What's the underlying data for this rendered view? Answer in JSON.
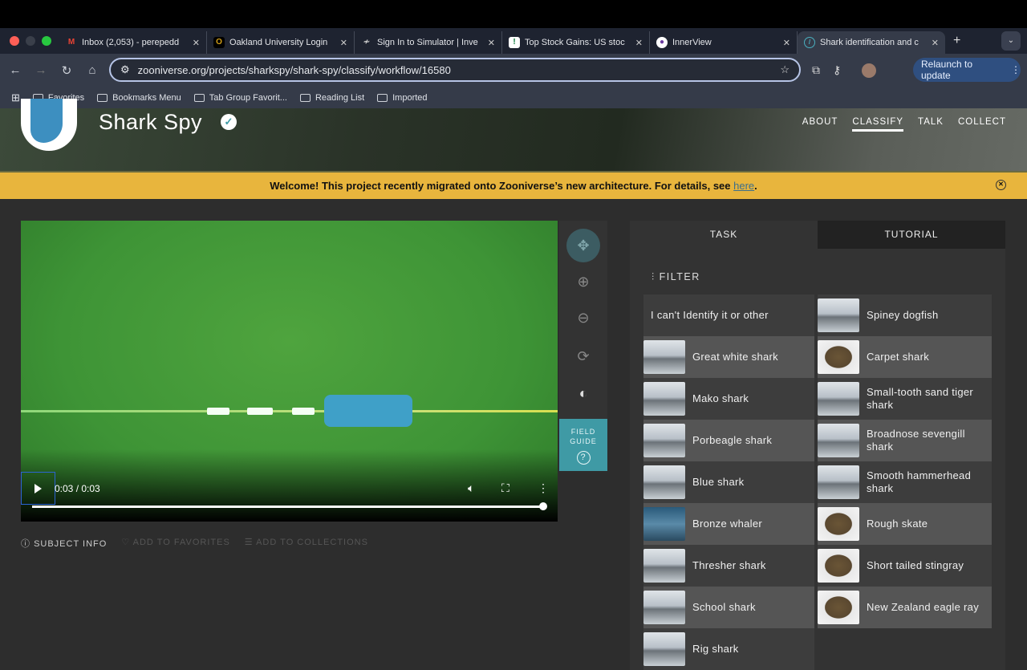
{
  "browser": {
    "tabs": [
      {
        "title": "Inbox (2,053) - perepedd",
        "icon": "gmail-icon"
      },
      {
        "title": "Oakland University Login",
        "icon": "ou-icon"
      },
      {
        "title": "Sign In to Simulator | Inve",
        "icon": "simulator-icon"
      },
      {
        "title": "Top Stock Gains: US stoc",
        "icon": "stock-icon"
      },
      {
        "title": "InnerView",
        "icon": "innerview-icon"
      },
      {
        "title": "Shark identification and c",
        "icon": "zooniverse-icon"
      }
    ],
    "url": "zooniverse.org/projects/sharkspy/shark-spy/classify/workflow/16580",
    "relaunch": "Relaunch to update",
    "bookmarks": [
      "Favorites",
      "Bookmarks Menu",
      "Tab Group Favorit...",
      "Reading List",
      "Imported"
    ]
  },
  "project": {
    "title": "Shark Spy",
    "nav": [
      "ABOUT",
      "CLASSIFY",
      "TALK",
      "COLLECT"
    ]
  },
  "banner": {
    "text": "Welcome! This project recently migrated onto Zooniverse’s new architecture. For details, see ",
    "link": "here",
    "end": "."
  },
  "video": {
    "time": "0:03 / 0:03",
    "progress": 1.0
  },
  "field_guide": "FIELD GUIDE",
  "meta": [
    "SUBJECT INFO",
    "ADD TO FAVORITES",
    "ADD TO COLLECTIONS"
  ],
  "panel": {
    "tabs": [
      "TASK",
      "TUTORIAL"
    ],
    "filter": "FILTER",
    "options": [
      "I can't Identify it or other",
      "Spiney dogfish",
      "Great white shark",
      "Carpet shark",
      "Mako shark",
      "Small-tooth sand tiger shark",
      "Porbeagle shark",
      "Broadnose sevengill shark",
      "Blue shark",
      "Smooth hammerhead shark",
      "Bronze whaler",
      "Rough skate",
      "Thresher shark",
      "Short tailed stingray",
      "School shark",
      "New Zealand eagle ray",
      "Rig shark"
    ]
  }
}
